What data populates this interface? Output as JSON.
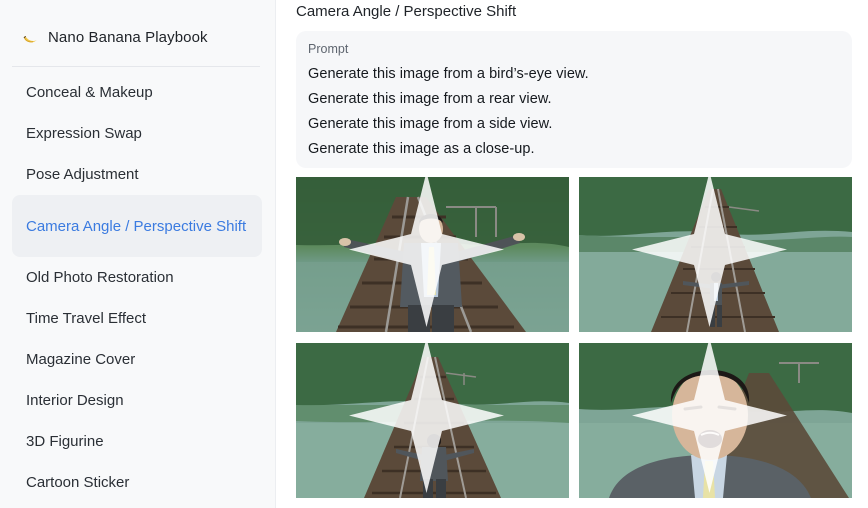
{
  "brand": {
    "title": "Nano Banana Playbook",
    "logo_icon": "banana-icon"
  },
  "sidebar": {
    "items": [
      {
        "label": "Conceal & Makeup",
        "active": false
      },
      {
        "label": "Expression Swap",
        "active": false
      },
      {
        "label": "Pose Adjustment",
        "active": false
      },
      {
        "label": "Camera Angle / Perspective Shift",
        "active": true
      },
      {
        "label": "Old Photo Restoration",
        "active": false
      },
      {
        "label": "Time Travel Effect",
        "active": false
      },
      {
        "label": "Magazine Cover",
        "active": false
      },
      {
        "label": "Interior Design",
        "active": false
      },
      {
        "label": "3D Figurine",
        "active": false
      },
      {
        "label": "Cartoon Sticker",
        "active": false
      }
    ]
  },
  "main": {
    "title": "Camera Angle / Perspective Shift",
    "prompt": {
      "label": "Prompt",
      "lines": [
        "Generate this image from a bird’s-eye view.",
        "Generate this image from a rear view.",
        "Generate this image from a side view.",
        "Generate this image as a close-up."
      ]
    },
    "images": [
      {
        "scene": "front-view-man-arms-out-on-railway-bridge"
      },
      {
        "scene": "birds-eye-view-man-on-railway-bridge"
      },
      {
        "scene": "rear-view-man-arms-out-on-railway-bridge"
      },
      {
        "scene": "close-up-man-shouting-on-railway-bridge"
      }
    ]
  },
  "colors": {
    "accent": "#3b7be0",
    "sidebar_bg": "#f8f9fa",
    "prompt_bg": "#f6f7f9"
  }
}
